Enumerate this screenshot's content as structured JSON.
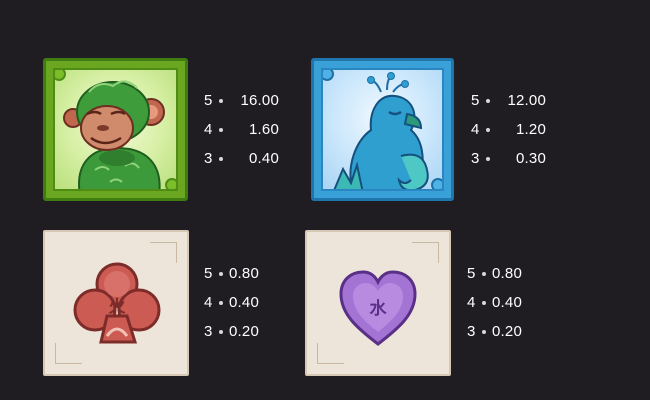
{
  "symbols": [
    {
      "name": "monkey",
      "icon": "monkey-icon",
      "colors": {
        "frame": "#6aa61f",
        "body": "#3d9a3a"
      },
      "pays": [
        {
          "count": "5",
          "value": "16.00"
        },
        {
          "count": "4",
          "value": "1.60"
        },
        {
          "count": "3",
          "value": "0.40"
        }
      ]
    },
    {
      "name": "peacock",
      "icon": "peacock-icon",
      "colors": {
        "frame": "#3aa0d8",
        "body": "#2f9fd0"
      },
      "pays": [
        {
          "count": "5",
          "value": "12.00"
        },
        {
          "count": "4",
          "value": "1.20"
        },
        {
          "count": "3",
          "value": "0.30"
        }
      ]
    },
    {
      "name": "fire-club",
      "icon": "club-icon",
      "glyph": "火",
      "colors": {
        "frame": "#ede5d9",
        "body": "#cc5b53"
      },
      "pays": [
        {
          "count": "5",
          "value": "0.80"
        },
        {
          "count": "4",
          "value": "0.40"
        },
        {
          "count": "3",
          "value": "0.20"
        }
      ]
    },
    {
      "name": "water-heart",
      "icon": "heart-icon",
      "glyph": "水",
      "colors": {
        "frame": "#ede5d9",
        "body": "#a474d4"
      },
      "pays": [
        {
          "count": "5",
          "value": "0.80"
        },
        {
          "count": "4",
          "value": "0.40"
        },
        {
          "count": "3",
          "value": "0.20"
        }
      ]
    }
  ]
}
